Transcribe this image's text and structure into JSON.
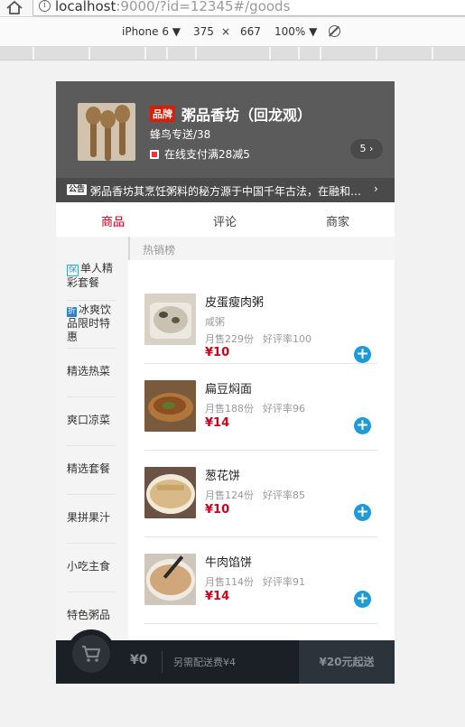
{
  "browser": {
    "url_host": "localhost",
    "url_rest": ":9000/?id=12345#/goods",
    "device": "iPhone 6",
    "width": "375",
    "times": "×",
    "height": "667",
    "zoom": "100%"
  },
  "seller": {
    "brand_badge": "品牌",
    "name": "粥品香坊（回龙观）",
    "delivery": "蜂鸟专送/38",
    "support": "在线支付满28减5",
    "support_count": "5 ›",
    "bulletin_tag": "公告",
    "bulletin": "粥品香坊其烹饪粥料的秘方源于中国千年古法，在融和现代制作工艺，由世代厨师精心熬制，精选食材",
    "bulletin_arrow": "›"
  },
  "tabs": [
    "商品",
    "评论",
    "商家"
  ],
  "menu": [
    {
      "icon": "保",
      "label": "单人精彩套餐"
    },
    {
      "icon": "折",
      "label": "冰爽饮品限时特惠"
    },
    {
      "label": "精选热菜"
    },
    {
      "label": "爽口凉菜"
    },
    {
      "label": "精选套餐"
    },
    {
      "label": "果拼果汁"
    },
    {
      "label": "小吃主食"
    },
    {
      "label": "特色粥品"
    }
  ],
  "foods": {
    "section_title": "热销榜",
    "items": [
      {
        "name": "皮蛋瘦肉粥",
        "desc": "咸粥",
        "sold": "月售229份",
        "rating": "好评率100",
        "price": "¥10"
      },
      {
        "name": "扁豆焖面",
        "sold": "月售188份",
        "rating": "好评率96",
        "price": "¥14"
      },
      {
        "name": "葱花饼",
        "sold": "月售124份",
        "rating": "好评率85",
        "price": "¥10"
      },
      {
        "name": "牛肉馅饼",
        "sold": "月售114份",
        "rating": "好评率91",
        "price": "¥14"
      }
    ],
    "add_symbol": "+"
  },
  "cart": {
    "total": "¥0",
    "fee": "另需配送费¥4",
    "min": "¥20元起送"
  },
  "colors": {
    "accent_red": "#d0021b",
    "add_blue": "#1d9ad8",
    "cart_bg": "#1b1f26"
  }
}
